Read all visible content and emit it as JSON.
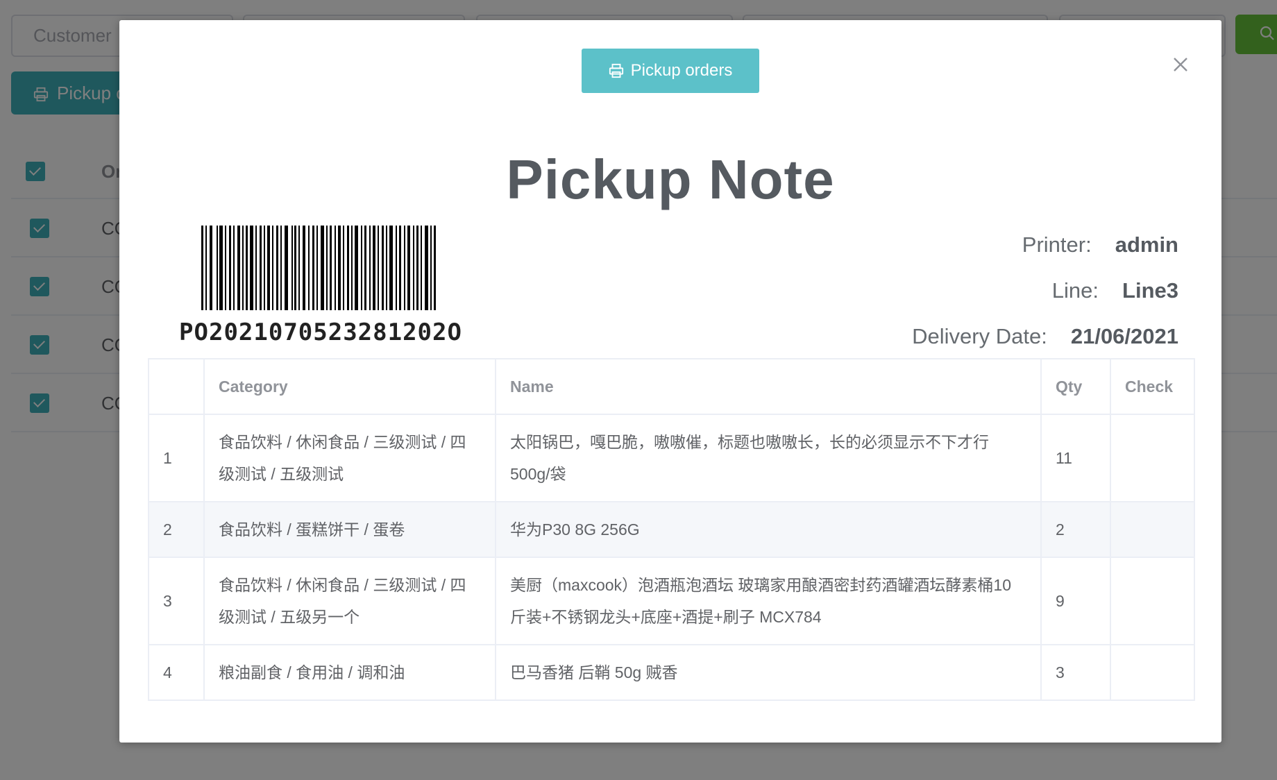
{
  "background": {
    "filter_placeholder": "Customer",
    "print_button_label": "Pickup orders",
    "table_header_first": "Or",
    "row_prefix": [
      "CO",
      "CO",
      "CO",
      "CO"
    ]
  },
  "dialog": {
    "print_button_label": "Pickup orders",
    "close_icon": "close-icon",
    "title": "Pickup Note",
    "barcode_value": "PO2021070523281202O",
    "printer_label": "Printer:",
    "printer_value": "admin",
    "line_label": "Line:",
    "line_value": "Line3",
    "date_label": "Delivery Date:",
    "date_value": "21/06/2021"
  },
  "table": {
    "columns": [
      "",
      "Category",
      "Name",
      "Qty",
      "Check"
    ],
    "rows": [
      {
        "index": "1",
        "category": "食品饮料 / 休闲食品 / 三级测试 / 四级测试 / 五级测试",
        "name": "太阳锅巴，嘎巴脆，嗷嗷催，标题也嗷嗷长，长的必须显示不下才行 500g/袋",
        "qty": "11",
        "check": ""
      },
      {
        "index": "2",
        "category": "食品饮料 / 蛋糕饼干 / 蛋卷",
        "name": "华为P30 8G 256G",
        "qty": "2",
        "check": ""
      },
      {
        "index": "3",
        "category": "食品饮料 / 休闲食品 / 三级测试 / 四级测试 / 五级另一个",
        "name": "美厨（maxcook）泡酒瓶泡酒坛 玻璃家用酿酒密封药酒罐酒坛酵素桶10斤装+不锈钢龙头+底座+酒提+刷子 MCX784",
        "qty": "9",
        "check": ""
      },
      {
        "index": "4",
        "category": "粮油副食 / 食用油 / 调和油",
        "name": "巴马香猪 后鞘 50g 贼香",
        "qty": "3",
        "check": ""
      }
    ]
  },
  "colors": {
    "accent": "#5cc1c9",
    "search_green": "#67c23a"
  }
}
